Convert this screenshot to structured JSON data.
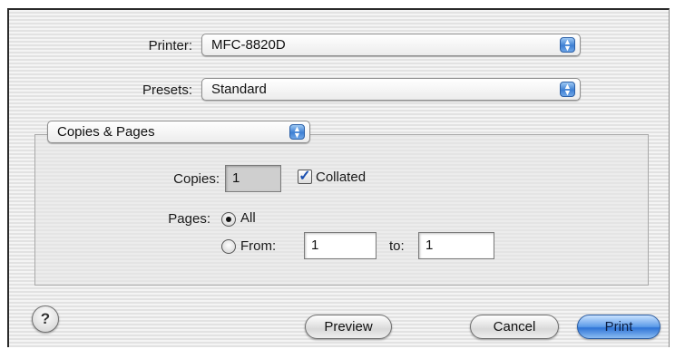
{
  "printer": {
    "label": "Printer:",
    "value": "MFC-8820D"
  },
  "presets": {
    "label": "Presets:",
    "value": "Standard"
  },
  "panel": {
    "value": "Copies & Pages"
  },
  "copies": {
    "label": "Copies:",
    "value": "1",
    "collated_label": "Collated",
    "collated_checked": true
  },
  "pages": {
    "label": "Pages:",
    "all_label": "All",
    "from_label": "From:",
    "from_value": "1",
    "to_label": "to:",
    "to_value": "1",
    "selected": "All"
  },
  "buttons": {
    "help": "?",
    "preview": "Preview",
    "cancel": "Cancel",
    "print": "Print"
  },
  "icons": {
    "popup_arrows": "up-down-arrows-icon",
    "checkmark": "check-icon"
  },
  "colors": {
    "accent": "#3d7fd3",
    "default_button": "#2f74d6"
  }
}
